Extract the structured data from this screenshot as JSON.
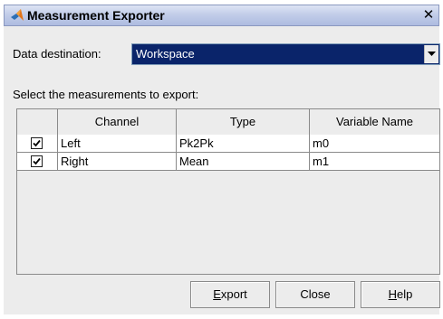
{
  "window": {
    "title": "Measurement Exporter",
    "close_glyph": "✕"
  },
  "destination": {
    "label": "Data destination:",
    "value": "Workspace"
  },
  "measurements": {
    "label": "Select the measurements to export:",
    "columns": [
      "",
      "Channel",
      "Type",
      "Variable Name"
    ],
    "rows": [
      {
        "checked": true,
        "channel": "Left",
        "type": "Pk2Pk",
        "variable": "m0"
      },
      {
        "checked": true,
        "channel": "Right",
        "type": "Mean",
        "variable": "m1"
      }
    ]
  },
  "buttons": {
    "export_underlined": "E",
    "export_rest": "xport",
    "close": "Close",
    "help_underlined": "H",
    "help_rest": "elp"
  },
  "icons": {
    "title": "matlab-logo-icon",
    "dropdown": "chevron-down-icon",
    "checkbox": "checkmark-icon"
  }
}
